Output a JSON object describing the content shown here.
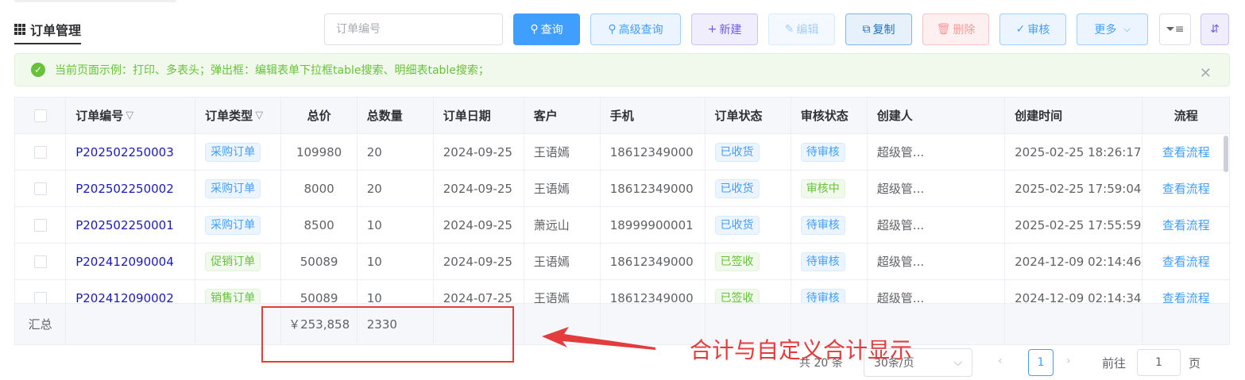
{
  "header": {
    "title": "订单管理",
    "search_placeholder": "订单编号",
    "buttons": {
      "query": "查询",
      "advanced_query": "高级查询",
      "new": "新建",
      "edit": "编辑",
      "copy": "复制",
      "delete": "删除",
      "audit": "审核",
      "more": "更多"
    }
  },
  "alert": {
    "text": "当前页面示例：打印、多表头；弹出框：编辑表单下拉框table搜索、明细表table搜索；"
  },
  "table": {
    "columns": [
      "订单编号",
      "订单类型",
      "总价",
      "总数量",
      "订单日期",
      "客户",
      "手机",
      "订单状态",
      "审核状态",
      "创建人",
      "创建时间",
      "流程"
    ],
    "rows": [
      {
        "no": "P202502250003",
        "type": "采购订单",
        "type_color": "blue",
        "price": "109980",
        "qty": "20",
        "date": "2024-09-25",
        "customer": "王语嫣",
        "phone": "18612349000",
        "status": "已收货",
        "status_color": "blue",
        "audit": "待审核",
        "audit_color": "blue",
        "creator": "超级管...",
        "created": "2025-02-25 18:26:17",
        "flow": "查看流程"
      },
      {
        "no": "P202502250002",
        "type": "采购订单",
        "type_color": "blue",
        "price": "8000",
        "qty": "20",
        "date": "2024-09-25",
        "customer": "王语嫣",
        "phone": "18612349000",
        "status": "已收货",
        "status_color": "blue",
        "audit": "审核中",
        "audit_color": "green",
        "creator": "超级管...",
        "created": "2025-02-25 17:59:04",
        "flow": "查看流程"
      },
      {
        "no": "P202502250001",
        "type": "采购订单",
        "type_color": "blue",
        "price": "8500",
        "qty": "10",
        "date": "2024-09-25",
        "customer": "萧远山",
        "phone": "18999900001",
        "status": "已收货",
        "status_color": "blue",
        "audit": "待审核",
        "audit_color": "blue",
        "creator": "超级管...",
        "created": "2025-02-25 17:55:59",
        "flow": "查看流程"
      },
      {
        "no": "P202412090004",
        "type": "促销订单",
        "type_color": "green",
        "price": "50089",
        "qty": "10",
        "date": "2024-09-25",
        "customer": "王语嫣",
        "phone": "18612349000",
        "status": "已签收",
        "status_color": "green",
        "audit": "待审核",
        "audit_color": "blue",
        "creator": "超级管...",
        "created": "2024-12-09 02:14:46",
        "flow": "查看流程"
      },
      {
        "no": "P202412090002",
        "type": "销售订单",
        "type_color": "green",
        "price": "50089",
        "qty": "10",
        "date": "2024-07-25",
        "customer": "王语嫣",
        "phone": "18612349000",
        "status": "已签收",
        "status_color": "green",
        "audit": "待审核",
        "audit_color": "blue",
        "creator": "超级管...",
        "created": "2024-12-09 02:14:34",
        "flow": "查看流程"
      }
    ],
    "summary": {
      "label": "汇总",
      "price": "￥253,858",
      "qty": "2330"
    }
  },
  "annotation": {
    "text": "合计与自定义合计显示"
  },
  "pagination": {
    "total": "共 20 条",
    "page_size": "30条/页",
    "current_page": "1",
    "goto_label": "前往",
    "goto_value": "1",
    "goto_unit": "页"
  },
  "colors": {
    "primary": "#409eff",
    "success": "#67c23a",
    "danger": "#e33c3c"
  }
}
